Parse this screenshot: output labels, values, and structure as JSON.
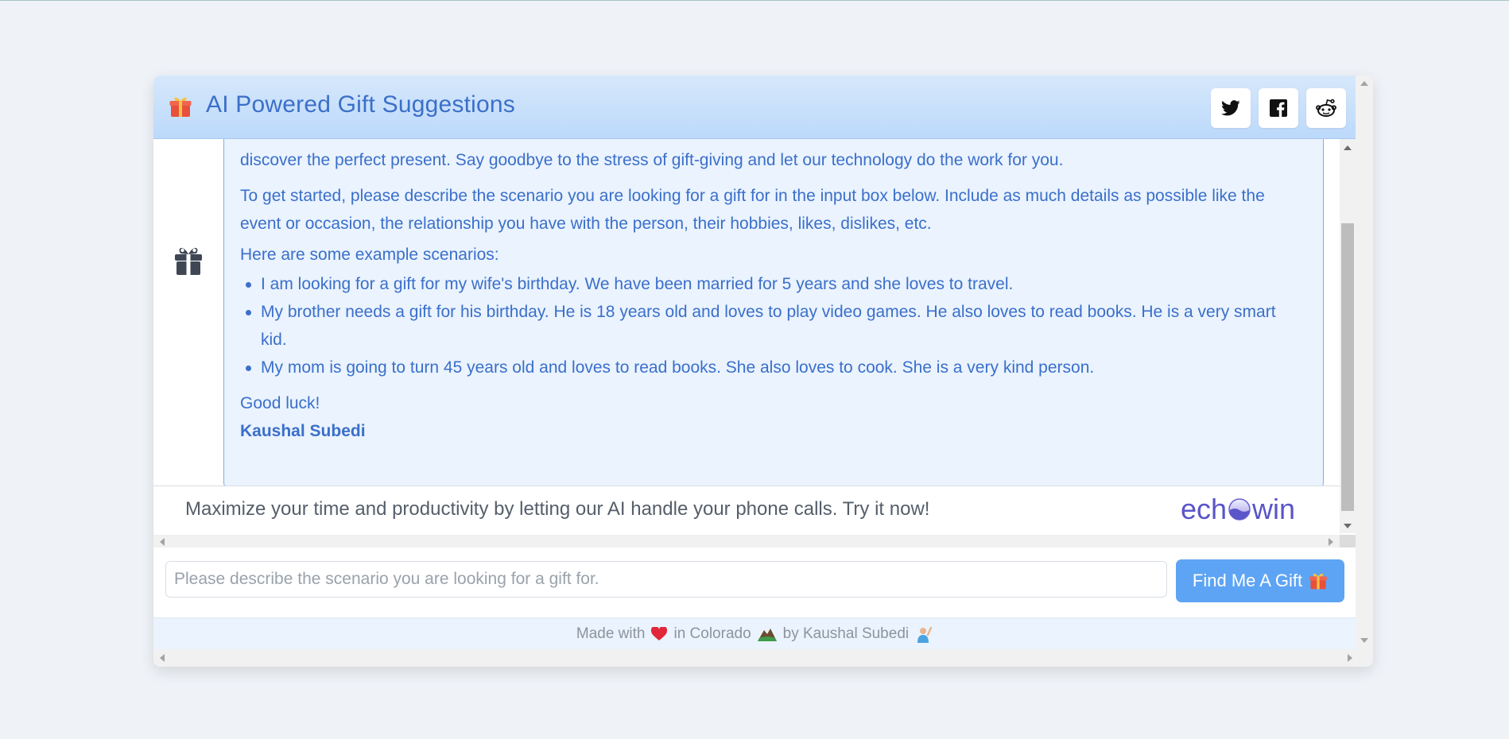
{
  "header": {
    "title": "AI Powered Gift Suggestions",
    "icon": "gift-emoji",
    "share": [
      "twitter-icon",
      "facebook-icon",
      "reddit-icon"
    ]
  },
  "message": {
    "intro_tail": "discover the perfect present. Say goodbye to the stress of gift-giving and let our technology do the work for you.",
    "instructions": "To get started, please describe the scenario you are looking for a gift for in the input box below. Include as much details as possible like the event or occasion, the relationship you have with the person, their hobbies, likes, dislikes, etc.",
    "examples_heading": "Here are some example scenarios:",
    "examples": [
      "I am looking for a gift for my wife's birthday. We have been married for 5 years and she loves to travel.",
      "My brother needs a gift for his birthday. He is 18 years old and loves to play video games. He also loves to read books. He is a very smart kid.",
      "My mom is going to turn 45 years old and loves to read books. She also loves to cook. She is a very kind person."
    ],
    "closing": "Good luck!",
    "author": "Kaushal Subedi"
  },
  "ad": {
    "text": "Maximize your time and productivity by letting our AI handle your phone calls. Try it now!",
    "logo_left": "ech",
    "logo_right": "win"
  },
  "input": {
    "placeholder": "Please describe the scenario you are looking for a gift for.",
    "value": "",
    "button_label": "Find Me A Gift"
  },
  "footer": {
    "made_with": "Made with",
    "in_place": "in Colorado",
    "by_author": "by Kaushal Subedi"
  },
  "colors": {
    "accent": "#3b6fc9",
    "button": "#5ea4f4",
    "message_bg": "#eaf3fe",
    "page_bg": "#eff3f8"
  }
}
